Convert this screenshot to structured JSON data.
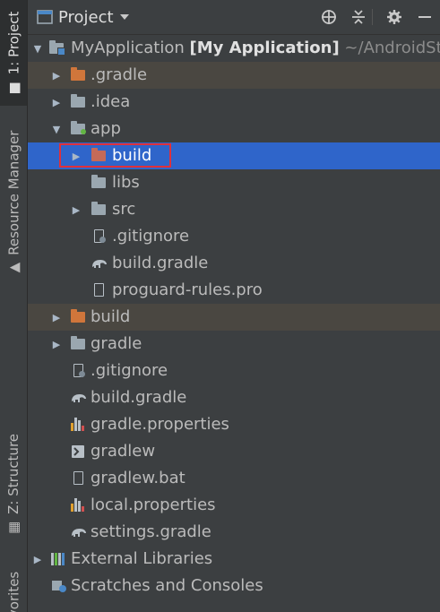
{
  "side_tabs": {
    "project": "1: Project",
    "resource_manager": "Resource Manager",
    "structure": "Z: Structure",
    "favorites": "avorites"
  },
  "header": {
    "title": "Project",
    "dropdown_icon": "chevron-down-icon",
    "actions": [
      "locate-icon",
      "collapse-all-icon",
      "gear-icon",
      "minimize-icon"
    ]
  },
  "tree": {
    "root": {
      "name": "MyApplication",
      "module": "[My Application]",
      "path": "~/AndroidStu"
    },
    "gradle_dir": ".gradle",
    "idea_dir": ".idea",
    "app": {
      "name": "app",
      "build": "build",
      "libs": "libs",
      "src": "src",
      "gitignore": ".gitignore",
      "build_gradle": "build.gradle",
      "proguard": "proguard-rules.pro"
    },
    "build_dir": "build",
    "gradle_folder": "gradle",
    "gitignore": ".gitignore",
    "build_gradle": "build.gradle",
    "gradle_properties": "gradle.properties",
    "gradlew": "gradlew",
    "gradlew_bat": "gradlew.bat",
    "local_properties": "local.properties",
    "settings_gradle": "settings.gradle",
    "external_libraries": "External Libraries",
    "scratches": "Scratches and Consoles"
  },
  "colors": {
    "selection": "#2f65ca",
    "excluded_folder": "#d0763b",
    "highlight_box": "#e0303a"
  }
}
